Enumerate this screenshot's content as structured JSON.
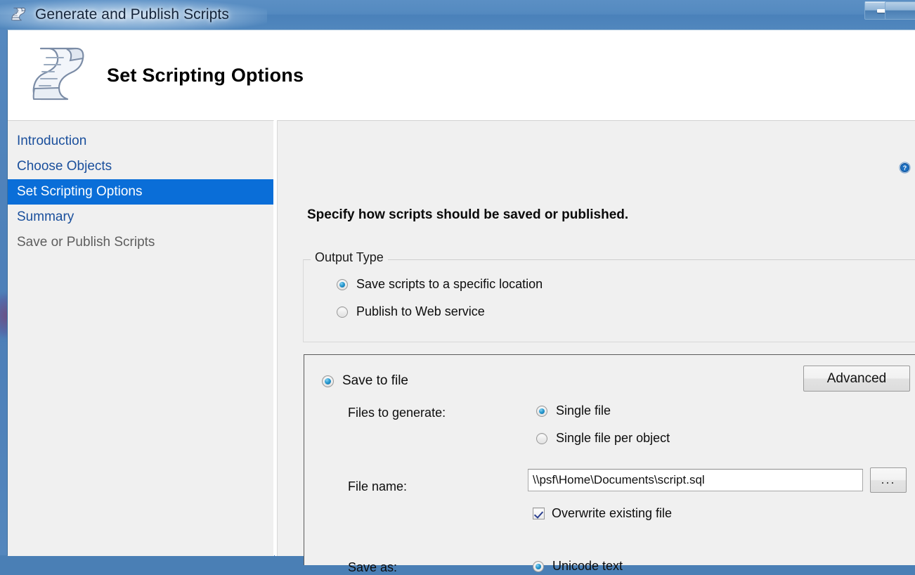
{
  "window": {
    "title": "Generate and Publish Scripts",
    "title_icon": "script-scroll-icon",
    "minimize_label": "Minimize"
  },
  "banner": {
    "icon": "script-scroll-icon",
    "title": "Set Scripting Options"
  },
  "sidebar": {
    "items": [
      {
        "label": "Introduction",
        "state": "link"
      },
      {
        "label": "Choose Objects",
        "state": "link"
      },
      {
        "label": "Set Scripting Options",
        "state": "selected"
      },
      {
        "label": "Summary",
        "state": "link"
      },
      {
        "label": "Save or Publish Scripts",
        "state": "disabled"
      }
    ]
  },
  "main": {
    "help_icon": "help-circle-icon",
    "instruction": "Specify how scripts should be saved or published.",
    "output_type": {
      "legend": "Output Type",
      "options": [
        {
          "label": "Save scripts to a specific location",
          "checked": true
        },
        {
          "label": "Publish to Web service",
          "checked": false
        }
      ]
    },
    "save_panel": {
      "save_to_file_label": "Save to file",
      "save_to_file_checked": true,
      "advanced_label": "Advanced",
      "files_to_generate_label": "Files to generate:",
      "files_to_generate_options": [
        {
          "label": "Single file",
          "checked": true
        },
        {
          "label": "Single file per object",
          "checked": false
        }
      ],
      "file_name_label": "File name:",
      "file_name_value": "\\\\psf\\Home\\Documents\\script.sql",
      "file_name_placeholder": "",
      "browse_label": "...",
      "overwrite_label": "Overwrite existing file",
      "overwrite_checked": true,
      "save_as_label": "Save as:",
      "save_as_options": [
        {
          "label": "Unicode text",
          "checked": true
        }
      ]
    }
  },
  "colors": {
    "accent_blue": "#0a6ed8",
    "link_blue": "#1a4f9c",
    "titlebar_blue": "#548ac0",
    "panel_gray": "#f0f0f0",
    "desktop_blue": "#4d7fb8"
  }
}
